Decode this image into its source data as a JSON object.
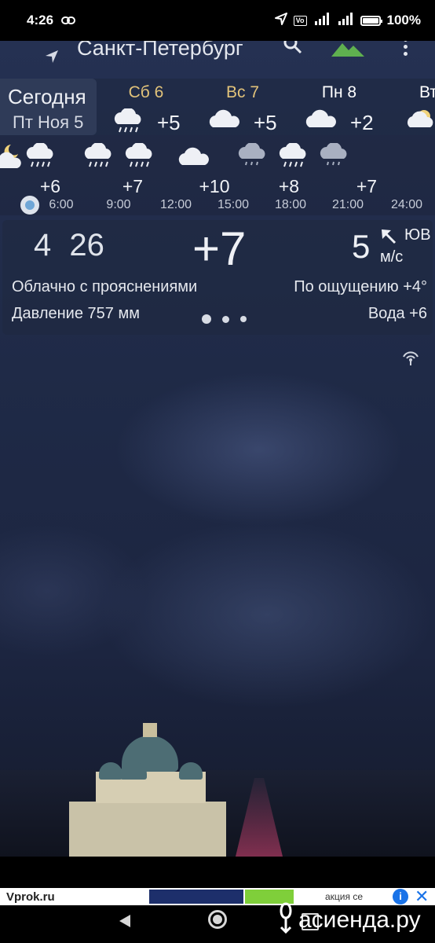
{
  "status_bar": {
    "time": "4:26",
    "battery": "100%",
    "battery_level": 1.0
  },
  "header": {
    "city": "Санкт-Петербург"
  },
  "days": {
    "today": {
      "label": "Сегодня",
      "date": "Пт Ноя 5"
    },
    "items": [
      {
        "name": "Сб 6",
        "temp": "+5",
        "icon": "rain-cloud-icon",
        "color": "#e2c37a"
      },
      {
        "name": "Вс 7",
        "temp": "+5",
        "icon": "cloud-icon",
        "color": "#e2c37a"
      },
      {
        "name": "Пн 8",
        "temp": "+2",
        "icon": "cloud-icon",
        "color": "#e8eaf0"
      },
      {
        "name": "Вт",
        "temp": "",
        "icon": "partly-cloudy-icon",
        "color": "#e8eaf0"
      }
    ]
  },
  "hourly": {
    "icons": [
      "moon-cloud-icon",
      "rain-cloud-icon",
      "rain-cloud-icon",
      "rain-cloud-icon",
      "cloud-icon",
      "drizzle-cloud-icon",
      "rain-cloud-icon",
      "drizzle-cloud-icon"
    ],
    "temps": [
      "+6",
      "+7",
      "+10",
      "+8",
      "+7"
    ],
    "times": [
      "6:00",
      "9:00",
      "12:00",
      "15:00",
      "18:00",
      "21:00",
      "24:00"
    ]
  },
  "current": {
    "time_hours": "4",
    "time_minutes": "26",
    "temp": "+7",
    "wind_speed": "5",
    "wind_dir": "ЮВ",
    "wind_unit": "м/с",
    "condition": "Облачно с прояснениями",
    "feels_like": "По ощущению +4°",
    "pressure": "Давление 757 мм",
    "water": "Вода +6"
  },
  "ad": {
    "left": "Vprok.ru",
    "right": "акция се",
    "info": "i",
    "close": "✕"
  },
  "watermark": "асиенда.ру"
}
